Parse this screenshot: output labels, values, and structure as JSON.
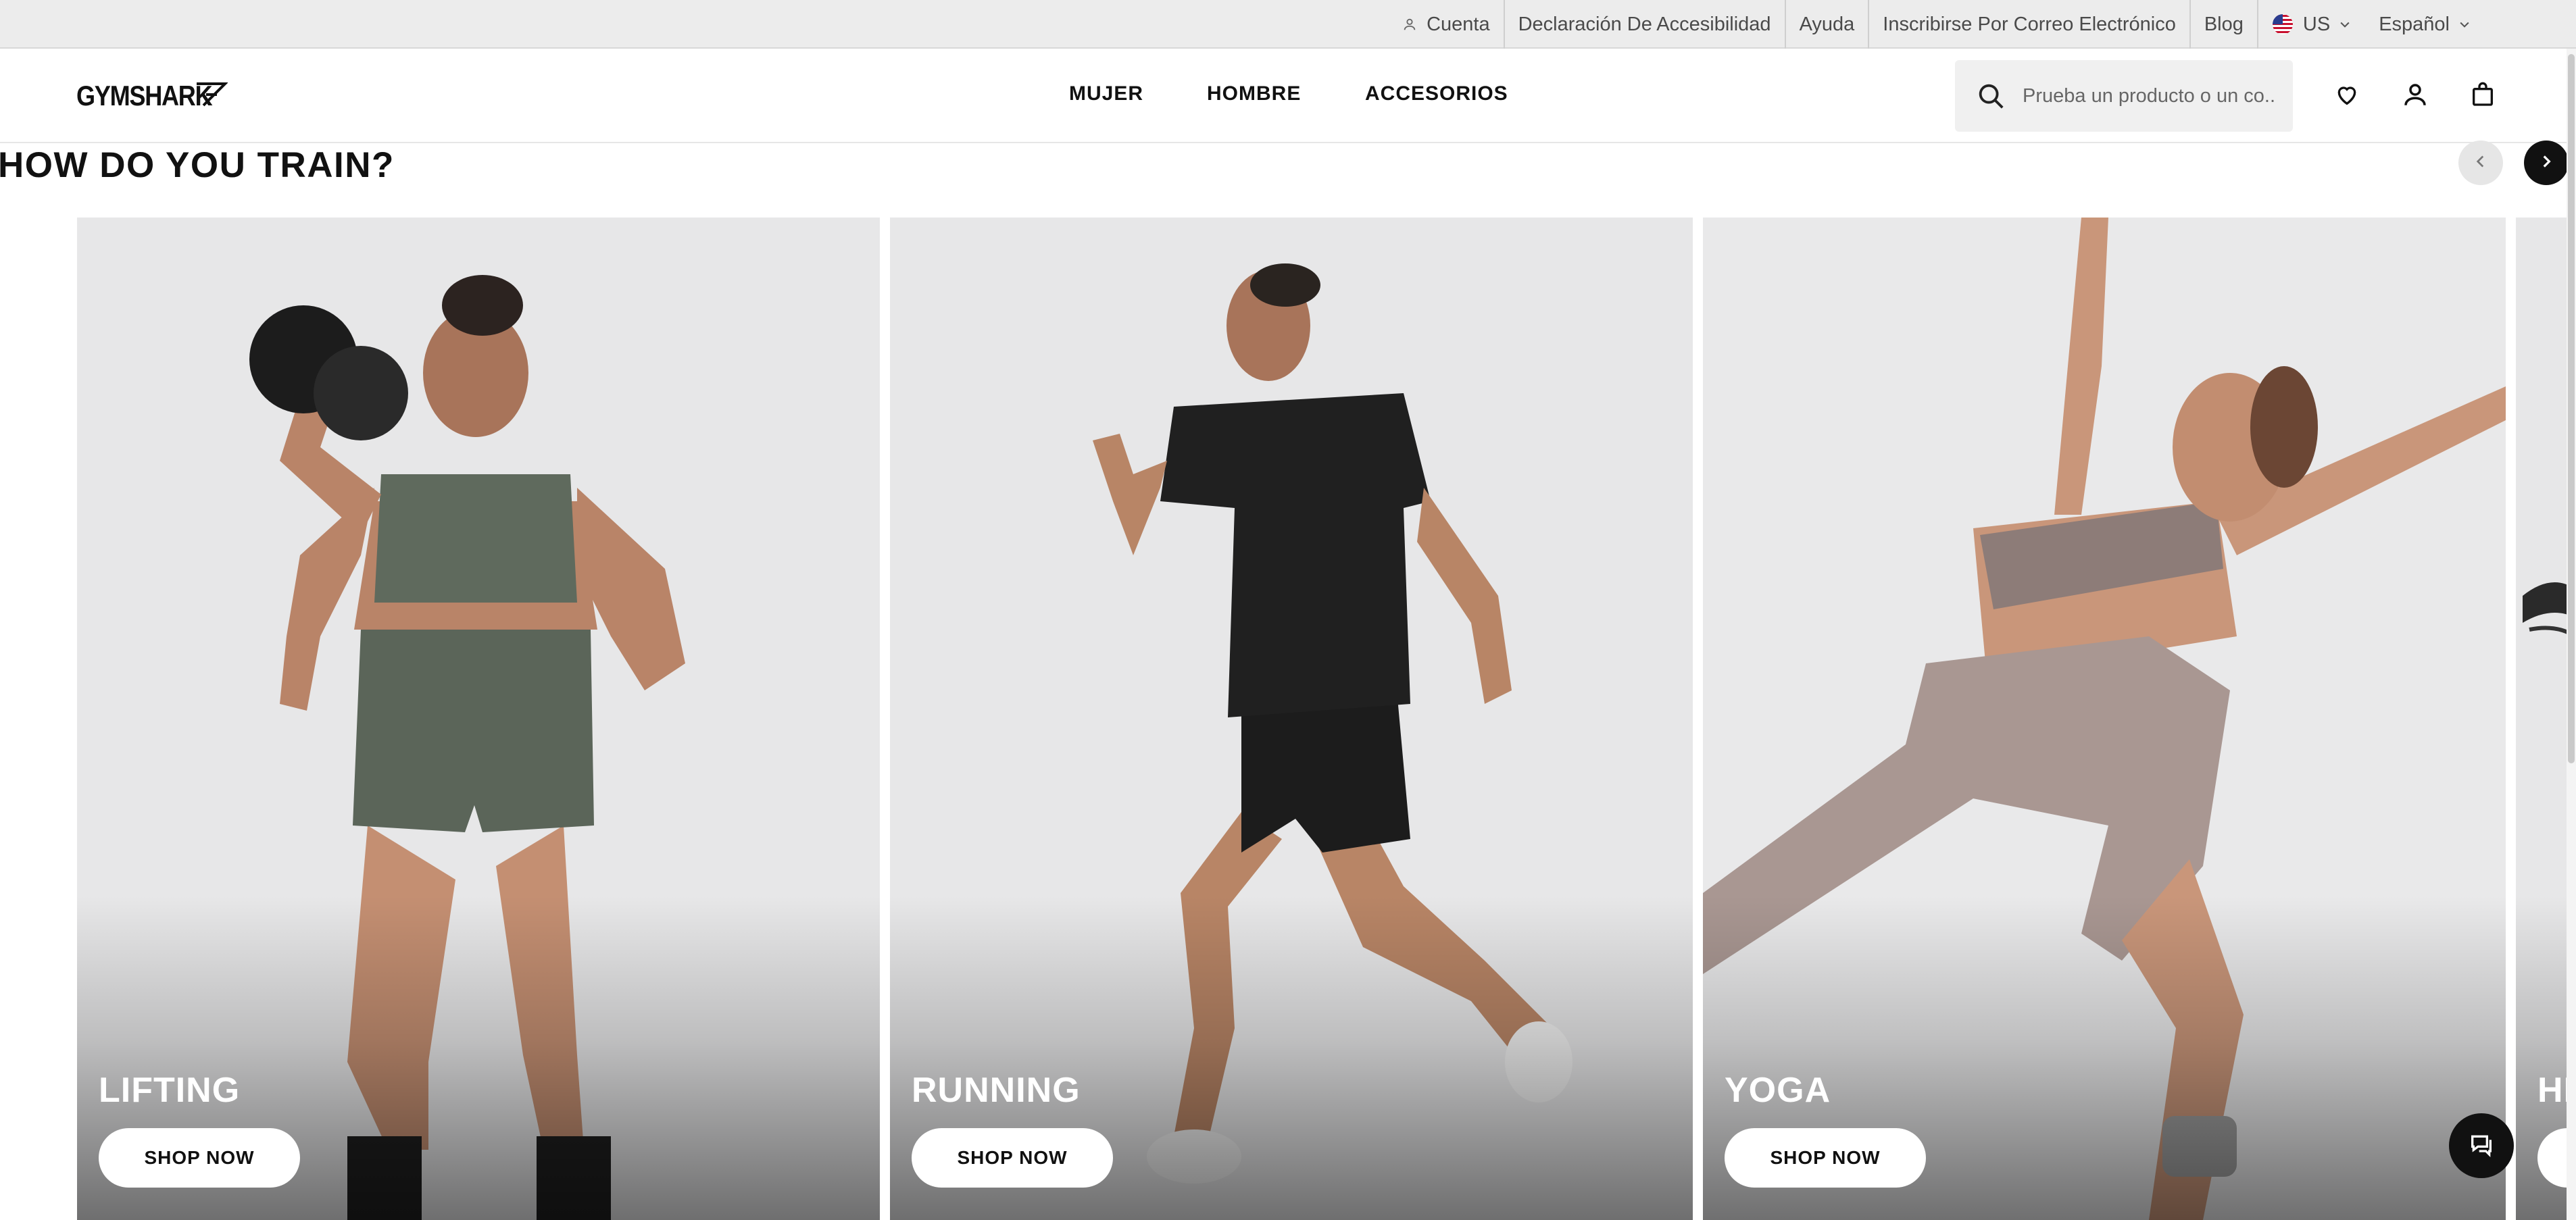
{
  "utility_bar": {
    "account_label": "Cuenta",
    "accessibility_label": "Declaración De Accesibilidad",
    "help_label": "Ayuda",
    "email_signup_label": "Inscribirse Por Correo Electrónico",
    "blog_label": "Blog",
    "region_label": "US",
    "language_label": "Español"
  },
  "header": {
    "logo_text": "GYMSHARK",
    "nav": [
      "MUJER",
      "HOMBRE",
      "ACCESORIOS"
    ],
    "search_placeholder": "Prueba un producto o un co..."
  },
  "section": {
    "title": "HOW DO YOU TRAIN?"
  },
  "cards": [
    {
      "title": "LIFTING",
      "cta": "SHOP NOW"
    },
    {
      "title": "RUNNING",
      "cta": "SHOP NOW"
    },
    {
      "title": "YOGA",
      "cta": "SHOP NOW"
    },
    {
      "title": "HI",
      "cta": ""
    }
  ],
  "icons": {
    "account": "user-icon",
    "region_flag": "us-flag-icon",
    "search": "search-icon",
    "wishlist": "heart-icon",
    "profile": "user-icon",
    "bag": "shopping-bag-icon",
    "prev": "chevron-left-icon",
    "next": "chevron-right-icon",
    "chat": "chat-icon"
  },
  "colors": {
    "utility_bg": "#ececec",
    "text_primary": "#111111",
    "card_bg": "#e5e5e6",
    "button_bg": "#ffffff"
  }
}
